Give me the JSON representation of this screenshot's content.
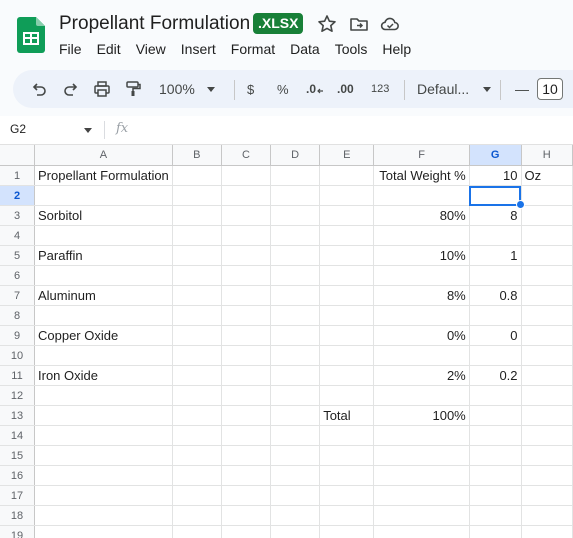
{
  "doc": {
    "title": "Propellant Formulation",
    "badge": ".XLSX"
  },
  "menu": [
    "File",
    "Edit",
    "View",
    "Insert",
    "Format",
    "Data",
    "Tools",
    "Help"
  ],
  "toolbar": {
    "zoom": "100%",
    "currency": "$",
    "percent": "%",
    "dec_decrease": ".0",
    "dec_increase": ".00",
    "number_format": "123",
    "font": "Defaul...",
    "font_size": "10",
    "minus": "—"
  },
  "namebox": "G2",
  "fx": "fx",
  "columns": [
    "A",
    "B",
    "C",
    "D",
    "E",
    "F",
    "G",
    "H"
  ],
  "selected_col": "G",
  "selected_row": "2",
  "rows": [
    {
      "n": "1",
      "A": "Propellant  Formulation",
      "E": "",
      "F": "Total Weight %",
      "G": "10",
      "H": "Oz"
    },
    {
      "n": "2",
      "A": "",
      "E": "",
      "F": "",
      "G": "",
      "H": ""
    },
    {
      "n": "3",
      "A": "Sorbitol",
      "E": "",
      "F": "80%",
      "G": "8",
      "H": ""
    },
    {
      "n": "4",
      "A": "",
      "E": "",
      "F": "",
      "G": "",
      "H": ""
    },
    {
      "n": "5",
      "A": "Paraffin",
      "E": "",
      "F": "10%",
      "G": "1",
      "H": ""
    },
    {
      "n": "6",
      "A": "",
      "E": "",
      "F": "",
      "G": "",
      "H": ""
    },
    {
      "n": "7",
      "A": "Aluminum",
      "E": "",
      "F": "8%",
      "G": "0.8",
      "H": ""
    },
    {
      "n": "8",
      "A": "",
      "E": "",
      "F": "",
      "G": "",
      "H": ""
    },
    {
      "n": "9",
      "A": "Copper Oxide",
      "E": "",
      "F": "0%",
      "G": "0",
      "H": ""
    },
    {
      "n": "10",
      "A": "",
      "E": "",
      "F": "",
      "G": "",
      "H": ""
    },
    {
      "n": "11",
      "A": "Iron Oxide",
      "E": "",
      "F": "2%",
      "G": "0.2",
      "H": ""
    },
    {
      "n": "12",
      "A": "",
      "E": "",
      "F": "",
      "G": "",
      "H": ""
    },
    {
      "n": "13",
      "A": "",
      "E": "Total",
      "F": "100%",
      "G": "",
      "H": ""
    },
    {
      "n": "14",
      "A": "",
      "E": "",
      "F": "",
      "G": "",
      "H": ""
    },
    {
      "n": "15",
      "A": "",
      "E": "",
      "F": "",
      "G": "",
      "H": ""
    },
    {
      "n": "16",
      "A": "",
      "E": "",
      "F": "",
      "G": "",
      "H": ""
    },
    {
      "n": "17",
      "A": "",
      "E": "",
      "F": "",
      "G": "",
      "H": ""
    },
    {
      "n": "18",
      "A": "",
      "E": "",
      "F": "",
      "G": "",
      "H": ""
    },
    {
      "n": "19",
      "A": "",
      "E": "",
      "F": "",
      "G": "",
      "H": ""
    }
  ]
}
